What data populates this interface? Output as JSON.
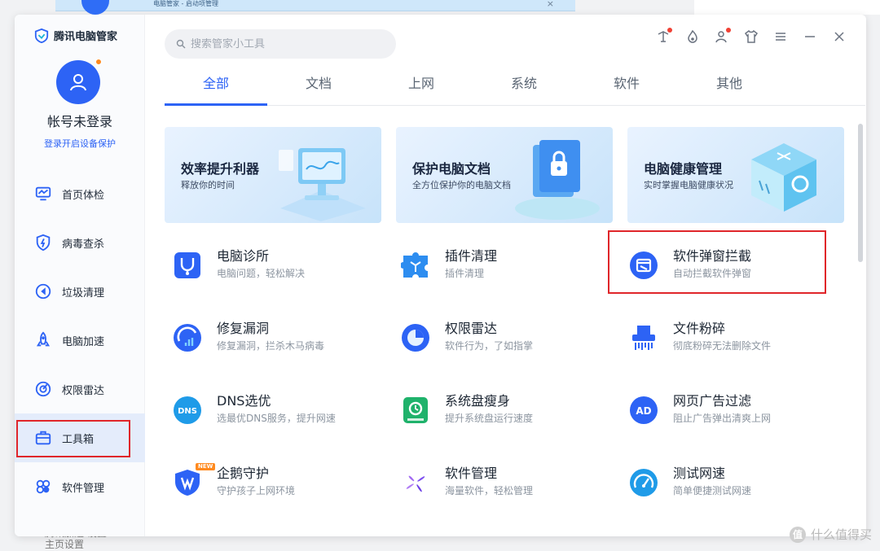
{
  "background": {
    "window_title": "电脑管家 - 启动项管理",
    "close_glyph": "×",
    "bottom_text_1": "腾讯加速 设置",
    "bottom_text_2": "主页设置"
  },
  "watermark": {
    "icon_text": "值",
    "text": "什么值得买"
  },
  "app": {
    "brand": "腾讯电脑管家",
    "account": {
      "name": "帐号未登录",
      "login_link": "登录开启设备保护"
    },
    "nav": [
      {
        "label": "首页体检",
        "icon": "monitor-icon"
      },
      {
        "label": "病毒查杀",
        "icon": "shield-icon"
      },
      {
        "label": "垃圾清理",
        "icon": "broom-icon"
      },
      {
        "label": "电脑加速",
        "icon": "rocket-icon"
      },
      {
        "label": "权限雷达",
        "icon": "radar-icon"
      },
      {
        "label": "工具箱",
        "icon": "toolbox-icon",
        "active": true
      },
      {
        "label": "软件管理",
        "icon": "apps-icon"
      }
    ],
    "search": {
      "placeholder": "搜索管家小工具"
    },
    "top_icons": [
      "skin-notify-icon",
      "flame-icon",
      "user-icon",
      "shirt-icon",
      "menu-icon",
      "minimize-icon",
      "close-icon"
    ],
    "tabs": [
      "全部",
      "文档",
      "上网",
      "系统",
      "软件",
      "其他"
    ],
    "active_tab": "全部",
    "banners": [
      {
        "title": "效率提升利器",
        "subtitle": "释放你的时间"
      },
      {
        "title": "保护电脑文档",
        "subtitle": "全方位保护你的电脑文档"
      },
      {
        "title": "电脑健康管理",
        "subtitle": "实时掌握电脑健康状况"
      }
    ],
    "tools": [
      [
        {
          "name": "电脑诊所",
          "desc": "电脑问题，轻松解决",
          "icon": "stethoscope-icon"
        },
        {
          "name": "插件清理",
          "desc": "插件清理",
          "icon": "puzzle-icon"
        },
        {
          "name": "软件弹窗拦截",
          "desc": "自动拦截软件弹窗",
          "icon": "popup-block-icon",
          "highlighted": true
        }
      ],
      [
        {
          "name": "修复漏洞",
          "desc": "修复漏洞，拦杀木马病毒",
          "icon": "patch-icon"
        },
        {
          "name": "权限雷达",
          "desc": "软件行为，了如指掌",
          "icon": "radar-icon"
        },
        {
          "name": "文件粉碎",
          "desc": "彻底粉碎无法删除文件",
          "icon": "shredder-icon"
        }
      ],
      [
        {
          "name": "DNS选优",
          "desc": "选最优DNS服务，提升网速",
          "icon": "dns-icon",
          "icon_text": "DNS"
        },
        {
          "name": "系统盘瘦身",
          "desc": "提升系统盘运行速度",
          "icon": "disk-slim-icon"
        },
        {
          "name": "网页广告过滤",
          "desc": "阻止广告弹出清爽上网",
          "icon": "ad-filter-icon",
          "icon_text": "AD"
        }
      ],
      [
        {
          "name": "企鹅守护",
          "desc": "守护孩子上网环境",
          "icon": "penguin-guard-icon",
          "badge": "NEW"
        },
        {
          "name": "软件管理",
          "desc": "海量软件，轻松管理",
          "icon": "software-manager-icon"
        },
        {
          "name": "测试网速",
          "desc": "简单便捷测试网速",
          "icon": "speedometer-icon"
        }
      ]
    ],
    "colors": {
      "accent": "#2d63f5",
      "highlight_border": "#e0262a",
      "nav_active_bg": "#e4ecfb"
    }
  }
}
